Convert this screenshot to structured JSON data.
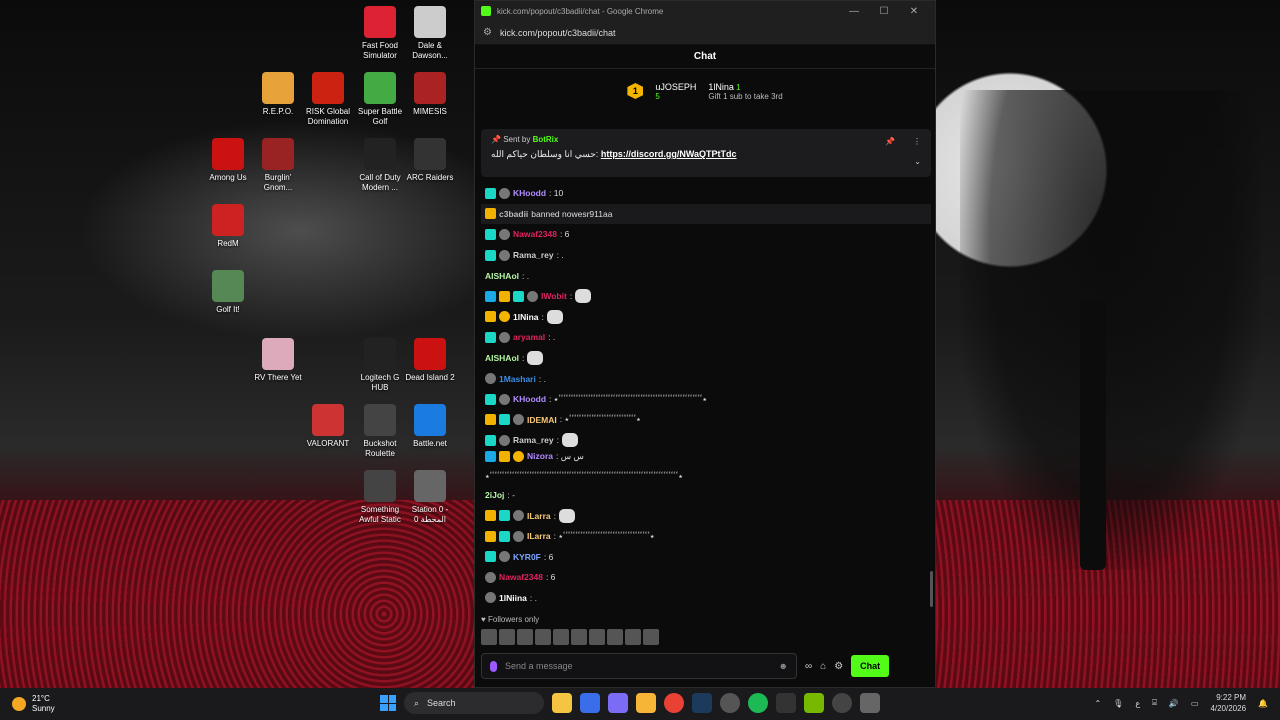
{
  "desktop": {
    "icons": [
      {
        "label": "Fast Food Simulator",
        "color": "#d23"
      },
      {
        "label": "Dale & Dawson...",
        "color": "#ccc"
      },
      {
        "label": "R.E.P.O.",
        "color": "#e8a23a"
      },
      {
        "label": "RISK Global Domination",
        "color": "#c21"
      },
      {
        "label": "Super Battle Golf",
        "color": "#4a4"
      },
      {
        "label": "MIMESIS",
        "color": "#a22"
      },
      {
        "label": "Among Us",
        "color": "#c11"
      },
      {
        "label": "Burglin' Gnom...",
        "color": "#922"
      },
      {
        "label": "Call of Duty Modern ...",
        "color": "#222"
      },
      {
        "label": "ARC Raiders",
        "color": "#333"
      },
      {
        "label": "RedM",
        "color": "#c22"
      },
      {
        "label": "Golf It!",
        "color": "#585"
      },
      {
        "label": "RV There Yet",
        "color": "#dab"
      },
      {
        "label": "Logitech G HUB",
        "color": "#222"
      },
      {
        "label": "Dead Island 2",
        "color": "#c11"
      },
      {
        "label": "VALORANT",
        "color": "#c33"
      },
      {
        "label": "Buckshot Roulette",
        "color": "#444"
      },
      {
        "label": "Battle.net",
        "color": "#1a7ce0"
      },
      {
        "label": "Something Awful Static",
        "color": "#444"
      },
      {
        "label": "Station 0 - المحطة 0",
        "color": "#666"
      }
    ]
  },
  "window": {
    "title": "kick.com/popout/c3badii/chat - Google Chrome",
    "url": "kick.com/popout/c3badii/chat",
    "minimize": "—",
    "maximize": "☐",
    "close": "✕"
  },
  "chat": {
    "header": "Chat",
    "leaderboard": {
      "first": {
        "rank": "1",
        "name": "uJOSEPH",
        "count": "5"
      },
      "second": {
        "name": "1lNina",
        "count": "1",
        "note": "Gift 1 sub to take 3rd"
      }
    },
    "pinned": {
      "sent_by_prefix": "Sent by",
      "sender": "BotRix",
      "text": "حسي انا وسلطان حياكم الله:",
      "link": "https://discord.gg/NWaQTPtTdc"
    },
    "messages": [
      {
        "badges": [
          "sub",
          "og"
        ],
        "user": "KHoodd",
        "color": "#b38cff",
        "text": ": 10"
      },
      {
        "mod": true,
        "badges": [
          "crown"
        ],
        "user": "c3badii",
        "color": "#bbb",
        "text": "banned nowesr911aa"
      },
      {
        "badges": [
          "sub",
          "og"
        ],
        "user": "Nawaf2348",
        "color": "#e0245e",
        "text": ": 6"
      },
      {
        "badges": [
          "sub",
          "og"
        ],
        "user": "Rama_rey",
        "color": "#ccc",
        "text": ": ."
      },
      {
        "badges": [],
        "user": "AISHAol",
        "color": "#b7f7a6",
        "text": ": ."
      },
      {
        "badges": [
          "vip",
          "crown",
          "sub",
          "og"
        ],
        "user": "lWobit",
        "color": "#e0245e",
        "text": ":",
        "emote": true
      },
      {
        "badges": [
          "crown",
          "gift"
        ],
        "user": "1lNina",
        "color": "#fff",
        "text": ":",
        "emote": true
      },
      {
        "badges": [
          "sub",
          "og"
        ],
        "user": "aryamal",
        "color": "#e0245e",
        "text": ": ."
      },
      {
        "badges": [],
        "user": "AISHAol",
        "color": "#b7f7a6",
        "text": ":",
        "emote": true
      },
      {
        "badges": [
          "og"
        ],
        "user": "1Mashari",
        "color": "#3a8ee6",
        "text": ": ."
      },
      {
        "badges": [
          "sub",
          "og"
        ],
        "user": "KHoodd",
        "color": "#b38cff",
        "text": ": ٭ٴٴٴٴٴٴٴٴٴٴٴٴٴٴٴٴٴٴٴٴٴٴٴٴٴٴٴٴٴٴٴٴٴٴٴٴٴٴٴٴٴٴٴٴٴٴٴٴٴٴٴٴٴٴٴٴٴٴ٭"
      },
      {
        "badges": [
          "crown",
          "sub",
          "og"
        ],
        "user": "IDEMAI",
        "color": "#f7c978",
        "text": ": ٭ٴٴٴٴٴٴٴٴٴٴٴٴٴٴٴٴٴٴٴٴٴٴٴٴٴٴٴ٭"
      },
      {
        "badges": [
          "sub",
          "og"
        ],
        "user": "Rama_rey",
        "color": "#ccc",
        "text": ":",
        "emote": true
      },
      {
        "badges": [
          "vip",
          "crown",
          "gift"
        ],
        "user": "Nizora",
        "color": "#b38cff",
        "text": ": س س",
        "wrap": "٭ٴٴٴٴٴٴٴٴٴٴٴٴٴٴٴٴٴٴٴٴٴٴٴٴٴٴٴٴٴٴٴٴٴٴٴٴٴٴٴٴٴٴٴٴٴٴٴٴٴٴٴٴٴٴٴٴٴٴٴٴٴٴٴٴٴٴٴٴٴٴٴٴٴٴٴٴ٭"
      },
      {
        "badges": [],
        "user": "2iJoj",
        "color": "#b7f7a6",
        "text": ": -"
      },
      {
        "badges": [
          "crown",
          "sub",
          "og"
        ],
        "user": "ILarra",
        "color": "#f7c978",
        "text": ":",
        "emote": true
      },
      {
        "badges": [
          "crown",
          "sub",
          "og"
        ],
        "user": "ILarra",
        "color": "#f7c978",
        "text": ": ٭ٴٴٴٴٴٴٴٴٴٴٴٴٴٴٴٴٴٴٴٴٴٴٴٴٴٴٴٴٴٴٴٴٴٴٴ٭"
      },
      {
        "badges": [
          "sub",
          "og"
        ],
        "user": "KYR0F",
        "color": "#7aa7ff",
        "text": ": 6"
      },
      {
        "badges": [
          "og"
        ],
        "user": "Nawaf2348",
        "color": "#e0245e",
        "text": ": 6"
      },
      {
        "badges": [
          "og"
        ],
        "user": "1lNiina",
        "color": "#fff",
        "text": ": ."
      }
    ],
    "followers_only": "Followers only",
    "input_placeholder": "Send a message",
    "send_button": "Chat"
  },
  "taskbar": {
    "weather_temp": "21°C",
    "weather_text": "Sunny",
    "search": "Search",
    "time": "9:22 PM",
    "date": "4/20/2026"
  }
}
